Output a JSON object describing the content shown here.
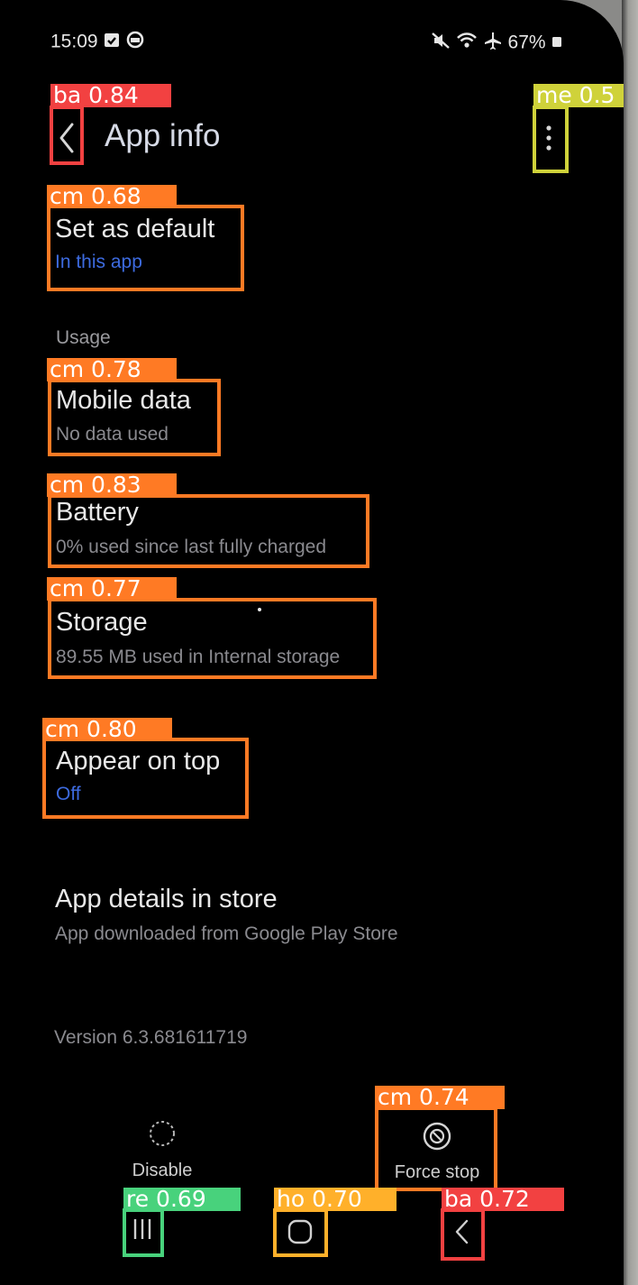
{
  "status_bar": {
    "time": "15:09",
    "battery": "67%",
    "left_icons": [
      "calendar-check-icon",
      "circle-face-icon"
    ],
    "right_icons": [
      "mute-icon",
      "wifi-icon",
      "airplane-icon",
      "battery-icon"
    ]
  },
  "header": {
    "title": "App info",
    "back_icon": "chevron-left-icon",
    "menu_icon": "more-vertical-icon"
  },
  "items": {
    "set_default": {
      "title": "Set as default",
      "subtitle": "In this app"
    },
    "usage_section": "Usage",
    "mobile_data": {
      "title": "Mobile data",
      "subtitle": "No data used"
    },
    "battery": {
      "title": "Battery",
      "subtitle": "0% used since last fully charged"
    },
    "storage": {
      "title": "Storage",
      "subtitle": "89.55 MB used in Internal storage"
    },
    "appear_on_top": {
      "title": "Appear on top",
      "subtitle": "Off"
    },
    "store_details": {
      "title": "App details in store",
      "subtitle": "App downloaded from Google Play Store"
    },
    "version": "Version 6.3.681611719"
  },
  "actions": {
    "disable_label": "Disable",
    "force_stop_label": "Force stop"
  },
  "navbar": {
    "recents_icon": "recents-icon",
    "home_icon": "home-icon",
    "back_icon": "back-icon"
  },
  "detections": {
    "back": "ba 0.84",
    "menu": "me 0.5",
    "set_default": "cm 0.68",
    "mobile_data": "cm 0.78",
    "battery": "cm 0.83",
    "storage": "cm 0.77",
    "appear_on_top": "cm 0.80",
    "force_stop": "cm 0.74",
    "recents": "re 0.69",
    "home": "ho 0.70",
    "nav_back": "ba 0.72"
  },
  "colors": {
    "screen_bg": "#000000",
    "accent_blue": "#3d6be0",
    "tag_orange": "#ff7a24",
    "tag_red": "#f24141",
    "tag_yellow": "#cfd23a",
    "tag_green": "#48d27c",
    "tag_amber": "#ffb02a"
  }
}
